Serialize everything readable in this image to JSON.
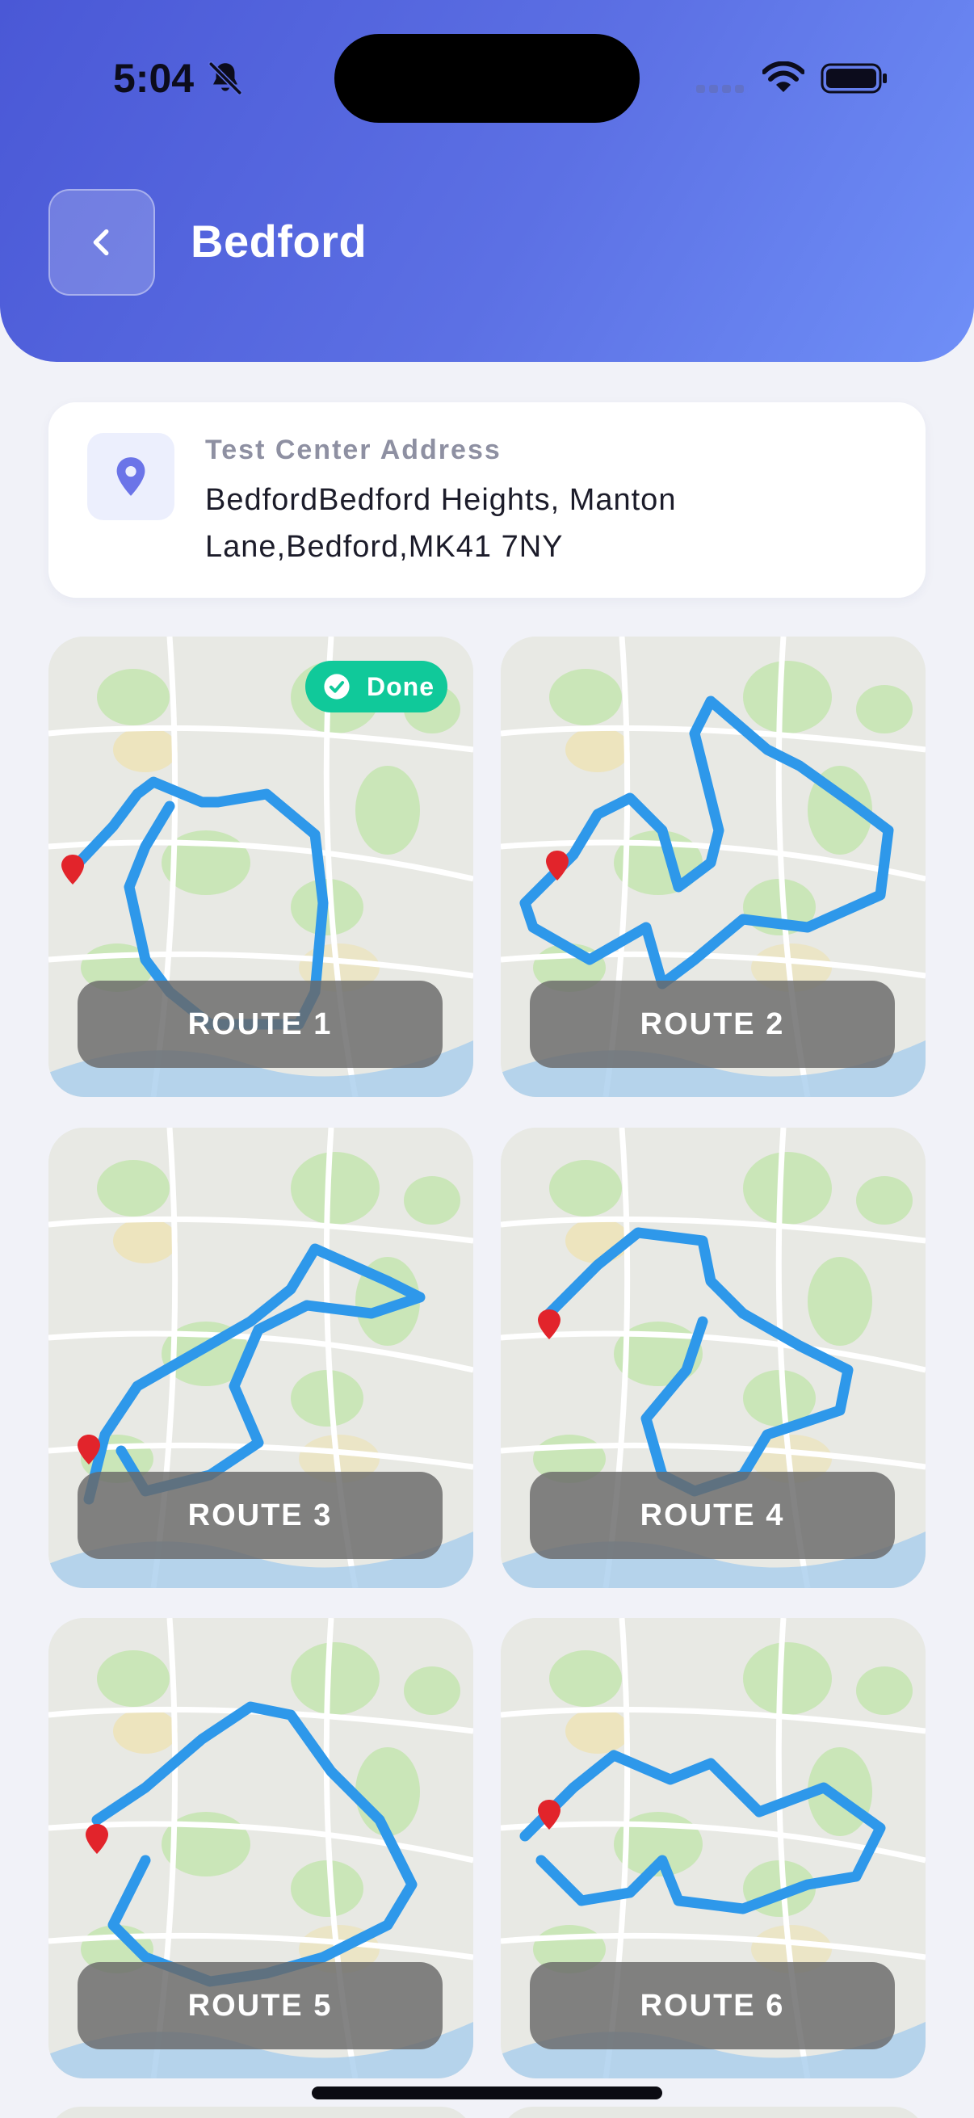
{
  "status_bar": {
    "time": "5:04"
  },
  "header": {
    "title": "Bedford"
  },
  "address": {
    "label": "Test Center Address",
    "value": "BedfordBedford Heights, Manton Lane,Bedford,MK41 7NY"
  },
  "routes": [
    {
      "label": "ROUTE 1",
      "done": true,
      "done_label": "Done"
    },
    {
      "label": "ROUTE 2",
      "done": false
    },
    {
      "label": "ROUTE 3",
      "done": false
    },
    {
      "label": "ROUTE 4",
      "done": false
    },
    {
      "label": "ROUTE 5",
      "done": false
    },
    {
      "label": "ROUTE 6",
      "done": false
    }
  ],
  "colors": {
    "header_start": "#4a58d6",
    "header_end": "#6f8ff7",
    "route_line": "#2e98ea",
    "done_badge": "#10c99a",
    "pin": "#6b74e8"
  },
  "icons": [
    "bell-slash-icon",
    "signal-icon",
    "wifi-icon",
    "battery-icon",
    "chevron-left-icon",
    "location-pin-icon",
    "check-circle-icon"
  ]
}
